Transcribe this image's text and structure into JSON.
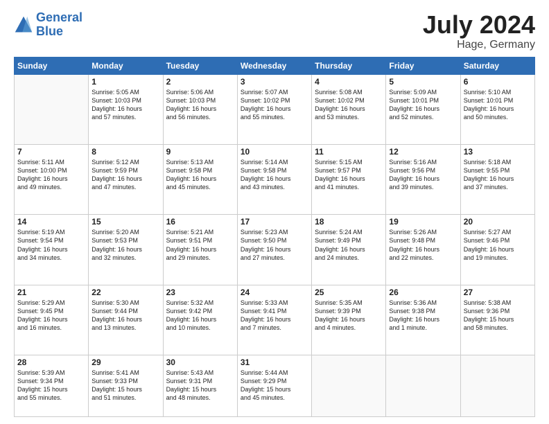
{
  "header": {
    "logo_line1": "General",
    "logo_line2": "Blue",
    "month_year": "July 2024",
    "location": "Hage, Germany"
  },
  "columns": [
    "Sunday",
    "Monday",
    "Tuesday",
    "Wednesday",
    "Thursday",
    "Friday",
    "Saturday"
  ],
  "weeks": [
    [
      {
        "day": "",
        "info": ""
      },
      {
        "day": "1",
        "info": "Sunrise: 5:05 AM\nSunset: 10:03 PM\nDaylight: 16 hours\nand 57 minutes."
      },
      {
        "day": "2",
        "info": "Sunrise: 5:06 AM\nSunset: 10:03 PM\nDaylight: 16 hours\nand 56 minutes."
      },
      {
        "day": "3",
        "info": "Sunrise: 5:07 AM\nSunset: 10:02 PM\nDaylight: 16 hours\nand 55 minutes."
      },
      {
        "day": "4",
        "info": "Sunrise: 5:08 AM\nSunset: 10:02 PM\nDaylight: 16 hours\nand 53 minutes."
      },
      {
        "day": "5",
        "info": "Sunrise: 5:09 AM\nSunset: 10:01 PM\nDaylight: 16 hours\nand 52 minutes."
      },
      {
        "day": "6",
        "info": "Sunrise: 5:10 AM\nSunset: 10:01 PM\nDaylight: 16 hours\nand 50 minutes."
      }
    ],
    [
      {
        "day": "7",
        "info": "Sunrise: 5:11 AM\nSunset: 10:00 PM\nDaylight: 16 hours\nand 49 minutes."
      },
      {
        "day": "8",
        "info": "Sunrise: 5:12 AM\nSunset: 9:59 PM\nDaylight: 16 hours\nand 47 minutes."
      },
      {
        "day": "9",
        "info": "Sunrise: 5:13 AM\nSunset: 9:58 PM\nDaylight: 16 hours\nand 45 minutes."
      },
      {
        "day": "10",
        "info": "Sunrise: 5:14 AM\nSunset: 9:58 PM\nDaylight: 16 hours\nand 43 minutes."
      },
      {
        "day": "11",
        "info": "Sunrise: 5:15 AM\nSunset: 9:57 PM\nDaylight: 16 hours\nand 41 minutes."
      },
      {
        "day": "12",
        "info": "Sunrise: 5:16 AM\nSunset: 9:56 PM\nDaylight: 16 hours\nand 39 minutes."
      },
      {
        "day": "13",
        "info": "Sunrise: 5:18 AM\nSunset: 9:55 PM\nDaylight: 16 hours\nand 37 minutes."
      }
    ],
    [
      {
        "day": "14",
        "info": "Sunrise: 5:19 AM\nSunset: 9:54 PM\nDaylight: 16 hours\nand 34 minutes."
      },
      {
        "day": "15",
        "info": "Sunrise: 5:20 AM\nSunset: 9:53 PM\nDaylight: 16 hours\nand 32 minutes."
      },
      {
        "day": "16",
        "info": "Sunrise: 5:21 AM\nSunset: 9:51 PM\nDaylight: 16 hours\nand 29 minutes."
      },
      {
        "day": "17",
        "info": "Sunrise: 5:23 AM\nSunset: 9:50 PM\nDaylight: 16 hours\nand 27 minutes."
      },
      {
        "day": "18",
        "info": "Sunrise: 5:24 AM\nSunset: 9:49 PM\nDaylight: 16 hours\nand 24 minutes."
      },
      {
        "day": "19",
        "info": "Sunrise: 5:26 AM\nSunset: 9:48 PM\nDaylight: 16 hours\nand 22 minutes."
      },
      {
        "day": "20",
        "info": "Sunrise: 5:27 AM\nSunset: 9:46 PM\nDaylight: 16 hours\nand 19 minutes."
      }
    ],
    [
      {
        "day": "21",
        "info": "Sunrise: 5:29 AM\nSunset: 9:45 PM\nDaylight: 16 hours\nand 16 minutes."
      },
      {
        "day": "22",
        "info": "Sunrise: 5:30 AM\nSunset: 9:44 PM\nDaylight: 16 hours\nand 13 minutes."
      },
      {
        "day": "23",
        "info": "Sunrise: 5:32 AM\nSunset: 9:42 PM\nDaylight: 16 hours\nand 10 minutes."
      },
      {
        "day": "24",
        "info": "Sunrise: 5:33 AM\nSunset: 9:41 PM\nDaylight: 16 hours\nand 7 minutes."
      },
      {
        "day": "25",
        "info": "Sunrise: 5:35 AM\nSunset: 9:39 PM\nDaylight: 16 hours\nand 4 minutes."
      },
      {
        "day": "26",
        "info": "Sunrise: 5:36 AM\nSunset: 9:38 PM\nDaylight: 16 hours\nand 1 minute."
      },
      {
        "day": "27",
        "info": "Sunrise: 5:38 AM\nSunset: 9:36 PM\nDaylight: 15 hours\nand 58 minutes."
      }
    ],
    [
      {
        "day": "28",
        "info": "Sunrise: 5:39 AM\nSunset: 9:34 PM\nDaylight: 15 hours\nand 55 minutes."
      },
      {
        "day": "29",
        "info": "Sunrise: 5:41 AM\nSunset: 9:33 PM\nDaylight: 15 hours\nand 51 minutes."
      },
      {
        "day": "30",
        "info": "Sunrise: 5:43 AM\nSunset: 9:31 PM\nDaylight: 15 hours\nand 48 minutes."
      },
      {
        "day": "31",
        "info": "Sunrise: 5:44 AM\nSunset: 9:29 PM\nDaylight: 15 hours\nand 45 minutes."
      },
      {
        "day": "",
        "info": ""
      },
      {
        "day": "",
        "info": ""
      },
      {
        "day": "",
        "info": ""
      }
    ]
  ]
}
